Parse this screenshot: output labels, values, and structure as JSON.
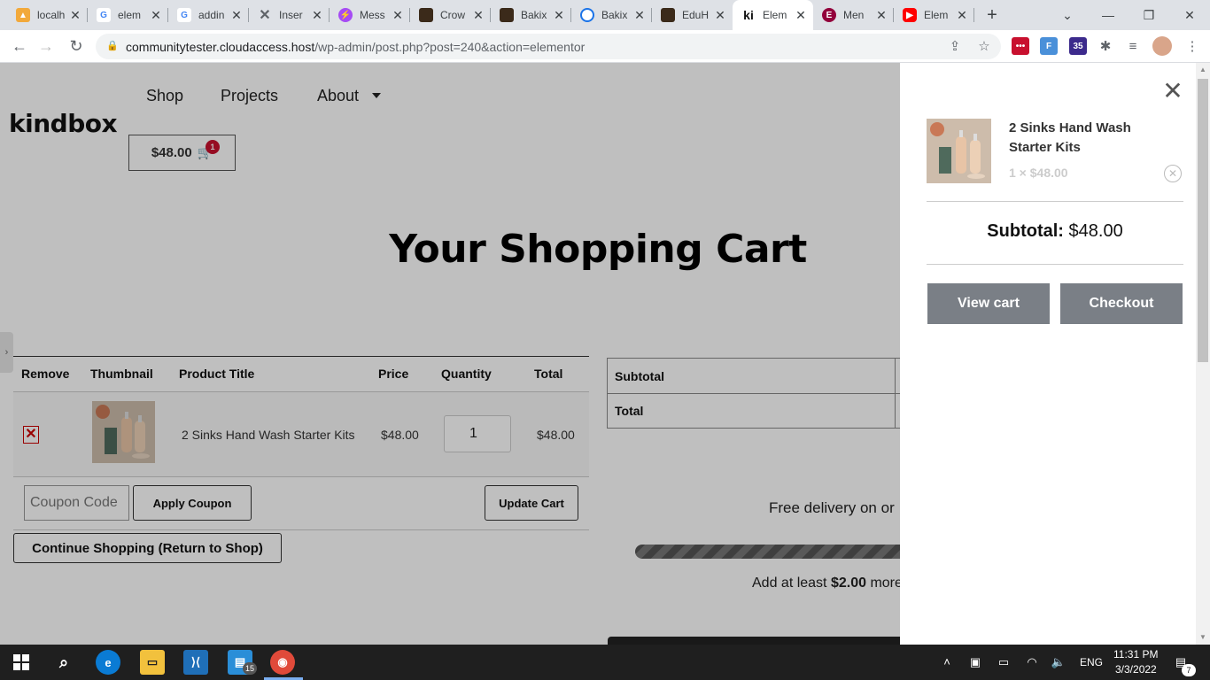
{
  "browser": {
    "tabs": [
      {
        "title": "localh",
        "favicon": "a-chart-icon",
        "color": "#f2a93b"
      },
      {
        "title": "elem",
        "favicon": "google-icon",
        "color": "#4285f4"
      },
      {
        "title": "addin",
        "favicon": "google-icon",
        "color": "#4285f4"
      },
      {
        "title": "Inser",
        "favicon": "x-icon",
        "color": "#5f6368"
      },
      {
        "title": "Mess",
        "favicon": "messenger-icon",
        "color": "#a64bf4"
      },
      {
        "title": "Crow",
        "favicon": "dark-square-icon",
        "color": "#3b2a1a"
      },
      {
        "title": "Bakix",
        "favicon": "dark-square-icon",
        "color": "#3b2a1a"
      },
      {
        "title": "Bakix",
        "favicon": "circle-icon",
        "color": "#1a73e8"
      },
      {
        "title": "EduH",
        "favicon": "dark-square-icon",
        "color": "#3b2a1a"
      },
      {
        "title": "Elem",
        "favicon": "ki-icon",
        "color": "#111111"
      },
      {
        "title": "Men",
        "favicon": "elementor-icon",
        "color": "#92003b"
      },
      {
        "title": "Elem",
        "favicon": "youtube-icon",
        "color": "#ff0000"
      }
    ],
    "new_tab": "+",
    "url_host": "communitytester.cloudaccess.host",
    "url_path": "/wp-admin/post.php?post=240&action=elementor",
    "extensions": [
      {
        "label": "•••",
        "color": "#c8102e"
      },
      {
        "label": "F",
        "color": "#4a90d9"
      },
      {
        "label": "35",
        "color": "#3c2a8c"
      }
    ]
  },
  "site": {
    "logo": "kindbox",
    "nav": [
      "Shop",
      "Projects",
      "About"
    ],
    "header_cart_total": "$48.00",
    "cart_badge_count": "1",
    "page_heading": "Your Shopping Cart"
  },
  "cart": {
    "headers": [
      "Remove",
      "Thumbnail",
      "Product Title",
      "Price",
      "Quantity",
      "Total"
    ],
    "row": {
      "remove": "✕",
      "product_title": "2 Sinks Hand Wash Starter Kits",
      "price": "$48.00",
      "quantity": "1",
      "total": "$48.00"
    },
    "coupon_placeholder": "Coupon Code",
    "apply_coupon": "Apply Coupon",
    "update_cart": "Update Cart",
    "continue_shopping": "Continue Shopping (Return to Shop)"
  },
  "totals": {
    "subtotal_label": "Subtotal",
    "total_label": "Total"
  },
  "shipping_notice": {
    "free_delivery": "Free delivery on or",
    "add_prefix": "Add at least ",
    "add_amount": "$2.00",
    "add_suffix": " more",
    "progress_fraction": 0.96
  },
  "minicart": {
    "product_title": "2 Sinks Hand Wash Starter Kits",
    "qty_price": "1 × $48.00",
    "subtotal_label": "Subtotal:",
    "subtotal_value": "$48.00",
    "view_cart": "View cart",
    "checkout": "Checkout"
  },
  "taskbar": {
    "time": "11:31 PM",
    "date": "3/3/2022",
    "language": "ENG",
    "files_badge": "15",
    "notifications": "7"
  }
}
